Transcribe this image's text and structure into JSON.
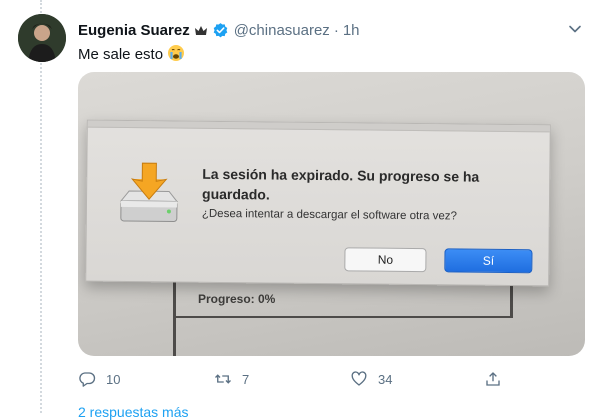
{
  "tweet": {
    "author_name": "Eugenia Suarez",
    "handle": "@chinasuarez",
    "separator": "·",
    "time": "1h",
    "text": "Me sale esto"
  },
  "media": {
    "background_label": "Progreso:  0%",
    "dialog": {
      "title": "La sesión ha expirado. Su progreso se ha guardado.",
      "message": "¿Desea intentar a descargar el software otra vez?",
      "no_button": "No",
      "yes_button": "Sí"
    }
  },
  "actions": {
    "replies": "10",
    "retweets": "7",
    "likes": "34"
  },
  "more_replies": "2 respuestas más",
  "colors": {
    "accent": "#1da1f2",
    "muted_text": "#5b7083",
    "dialog_primary": "#2a7cf0"
  }
}
